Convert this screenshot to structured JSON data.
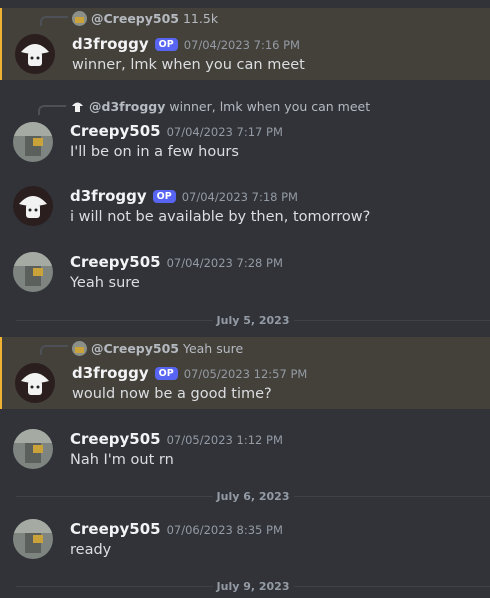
{
  "messages": [
    {
      "author": "d3froggy",
      "op_badge": "OP",
      "timestamp": "07/04/2023 7:16 PM",
      "text": "winner, lmk when you can meet",
      "reply": {
        "author": "@Creepy505",
        "text": "11.5k"
      },
      "highlighted": true
    },
    {
      "author": "Creepy505",
      "timestamp": "07/04/2023 7:17 PM",
      "text": "I'll be on in a few hours",
      "reply": {
        "author": "@d3froggy",
        "text": "winner, lmk when you can meet"
      }
    },
    {
      "author": "d3froggy",
      "op_badge": "OP",
      "timestamp": "07/04/2023 7:18 PM",
      "text": "i will not be available by then, tomorrow?"
    },
    {
      "author": "Creepy505",
      "timestamp": "07/04/2023 7:28 PM",
      "text": "Yeah sure"
    },
    {
      "author": "d3froggy",
      "op_badge": "OP",
      "timestamp": "07/05/2023 12:57 PM",
      "text": "would now be a good time?",
      "reply": {
        "author": "@Creepy505",
        "text": "Yeah sure"
      },
      "highlighted": true
    },
    {
      "author": "Creepy505",
      "timestamp": "07/05/2023 1:12 PM",
      "text": "Nah I'm out rn"
    },
    {
      "author": "Creepy505",
      "timestamp": "07/06/2023 8:35 PM",
      "text": "ready"
    }
  ],
  "dividers": [
    "July 5, 2023",
    "July 6, 2023",
    "July 9, 2023"
  ],
  "colors": {
    "background": "#313338",
    "highlight": "#44403a",
    "op_badge": "#5865f2"
  }
}
